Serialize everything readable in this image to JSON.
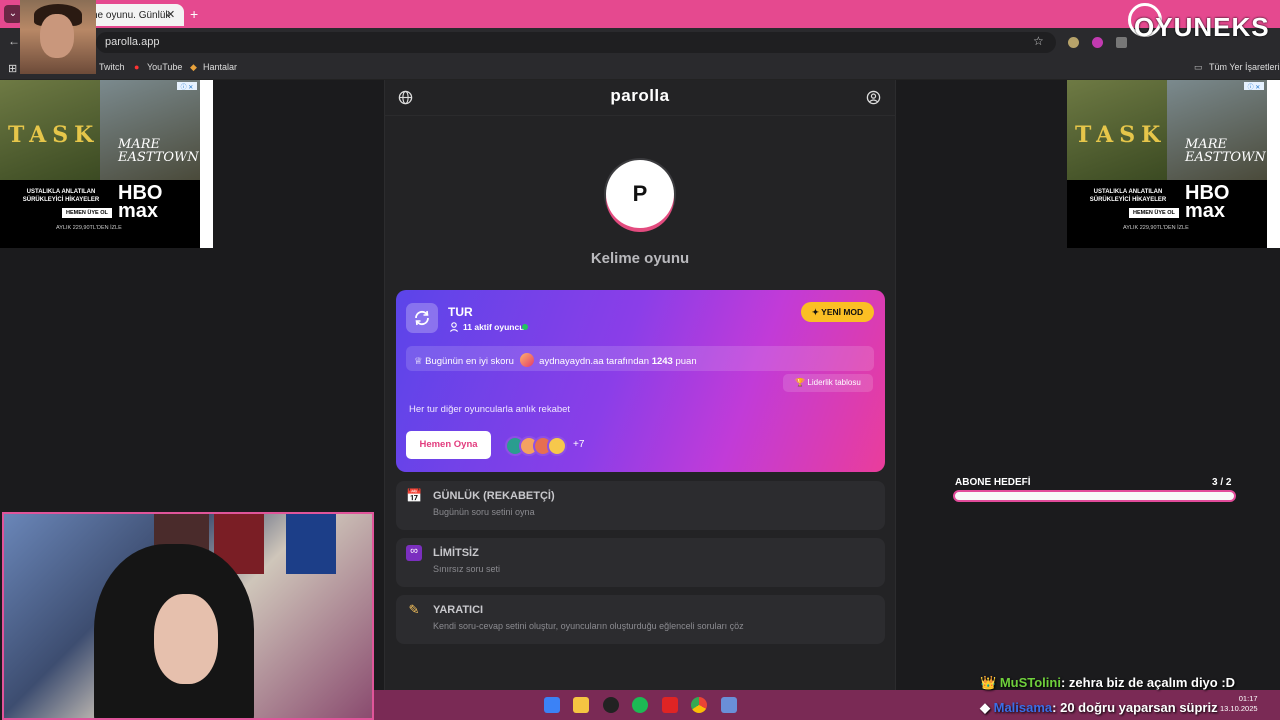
{
  "browser": {
    "tab_title": "ne oyunu. Günlük",
    "url": "parolla.app",
    "bookmarks": [
      "Twitch",
      "YouTube",
      "Hantalar"
    ],
    "all_bookmarks": "Tüm Yer İşaretleri"
  },
  "ad": {
    "title1": "TASK",
    "title2": "MARE\nof EASTTOWN",
    "tagline": "USTALIKLA ANLATILAN SÜRÜKLEYİCİ HİKAYELER",
    "brand": "HBO max",
    "cta": "HEMEN ÜYE OL",
    "price": "AYLIK 229,90TL'DEN İZLE"
  },
  "app": {
    "brand": "parolla",
    "logo_letter": "P",
    "subtitle": "Kelime oyunu",
    "card": {
      "title": "TUR",
      "active_players": "11 aktif oyuncu",
      "new_mode": "YENİ MOD",
      "best_score_label": "Bugünün en iyi skoru",
      "best_user": "aydnayaydn.aa",
      "by_text": "tarafından",
      "score": "1243",
      "points": "puan",
      "leaderboard": "Liderlik tablosu",
      "description": "Her tur diğer oyuncularla anlık rekabet",
      "play_button": "Hemen Oyna",
      "more_players": "+7"
    },
    "modes": [
      {
        "icon": "calendar-icon",
        "title": "GÜNLÜK (REKABETÇİ)",
        "subtitle": "Bugünün soru setini oyna"
      },
      {
        "icon": "infinity-icon",
        "title": "LİMİTSİZ",
        "subtitle": "Sınırsız soru seti"
      },
      {
        "icon": "pencil-icon",
        "title": "YARATICI",
        "subtitle": "Kendi soru-cevap setini oluştur, oyuncuların oluşturduğu eğlenceli soruları çöz"
      }
    ]
  },
  "overlay": {
    "goal_label": "ABONE HEDEFİ",
    "goal_count": "3 / 2",
    "chat": [
      {
        "user": "MuSTolini",
        "message": ": zehra biz de açalım diyo :D"
      },
      {
        "user": "Malisama",
        "message": ": 20 doğru yaparsan süpriz"
      }
    ],
    "watermark": "OYUNEKS"
  },
  "taskbar": {
    "time": "01:17",
    "date": "13.10.2025"
  },
  "colors": {
    "accent_pink": "#e5498f",
    "card_start": "#5b45e9",
    "card_end": "#ea3d9b",
    "new_mode_yellow": "#fbbf24"
  }
}
